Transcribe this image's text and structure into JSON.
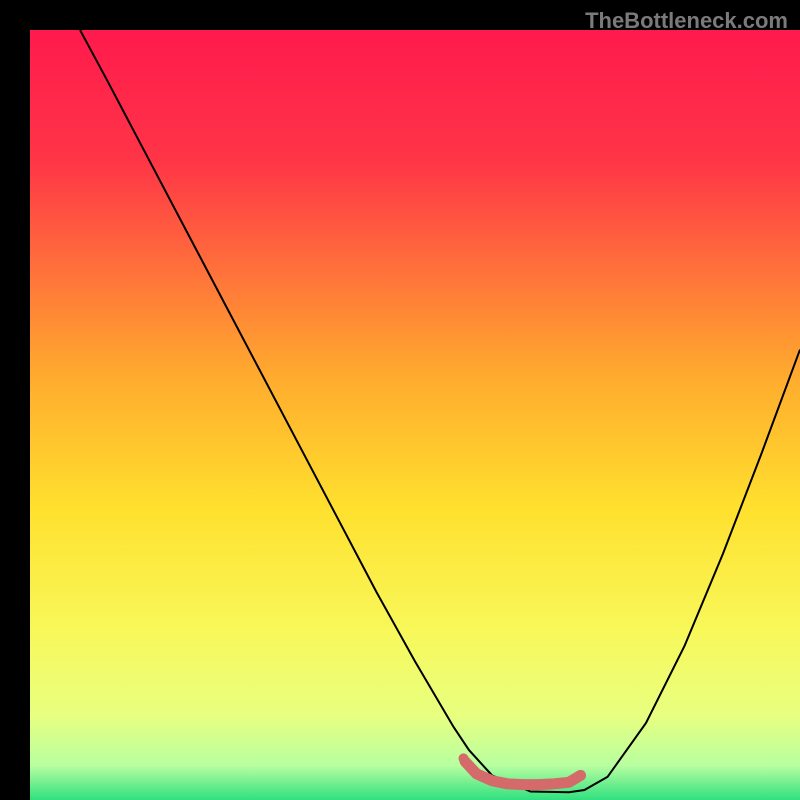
{
  "watermark": "TheBottleneck.com",
  "chart_data": {
    "type": "line",
    "title": "",
    "xlabel": "",
    "ylabel": "",
    "xlim": [
      0,
      100
    ],
    "ylim": [
      0,
      100
    ],
    "gradient_stops": [
      {
        "offset": 0,
        "color": "#ff1a4d"
      },
      {
        "offset": 0.17,
        "color": "#ff3547"
      },
      {
        "offset": 0.45,
        "color": "#ffab2e"
      },
      {
        "offset": 0.62,
        "color": "#ffe02e"
      },
      {
        "offset": 0.78,
        "color": "#f8f85a"
      },
      {
        "offset": 0.89,
        "color": "#e8ff80"
      },
      {
        "offset": 0.955,
        "color": "#b8ffa0"
      },
      {
        "offset": 1.0,
        "color": "#30e080"
      }
    ],
    "series": [
      {
        "name": "curve",
        "color": "#000000",
        "stroke_width": 2,
        "x": [
          6.5,
          10,
          15,
          20,
          25,
          30,
          35,
          40,
          45,
          50,
          55,
          57,
          60,
          65,
          70,
          72,
          75,
          80,
          85,
          90,
          95,
          100
        ],
        "y": [
          100,
          93.5,
          84,
          74.5,
          65,
          55.5,
          46,
          36.5,
          27,
          18,
          9.5,
          6.5,
          3.2,
          1.1,
          1.0,
          1.3,
          3.0,
          10,
          20,
          32,
          45,
          58.5
        ]
      },
      {
        "name": "optimal-range",
        "color": "#d46a6a",
        "stroke_width": 11,
        "cap": "round",
        "x": [
          56.5,
          58,
          60,
          62,
          64,
          66,
          68,
          70,
          71.5
        ],
        "y": [
          5.0,
          3.4,
          2.5,
          2.1,
          2.0,
          2.0,
          2.1,
          2.3,
          3.2
        ]
      }
    ],
    "markers": [
      {
        "name": "start-dot",
        "x": 56.3,
        "y": 5.4,
        "r": 5,
        "color": "#d46a6a"
      }
    ]
  }
}
